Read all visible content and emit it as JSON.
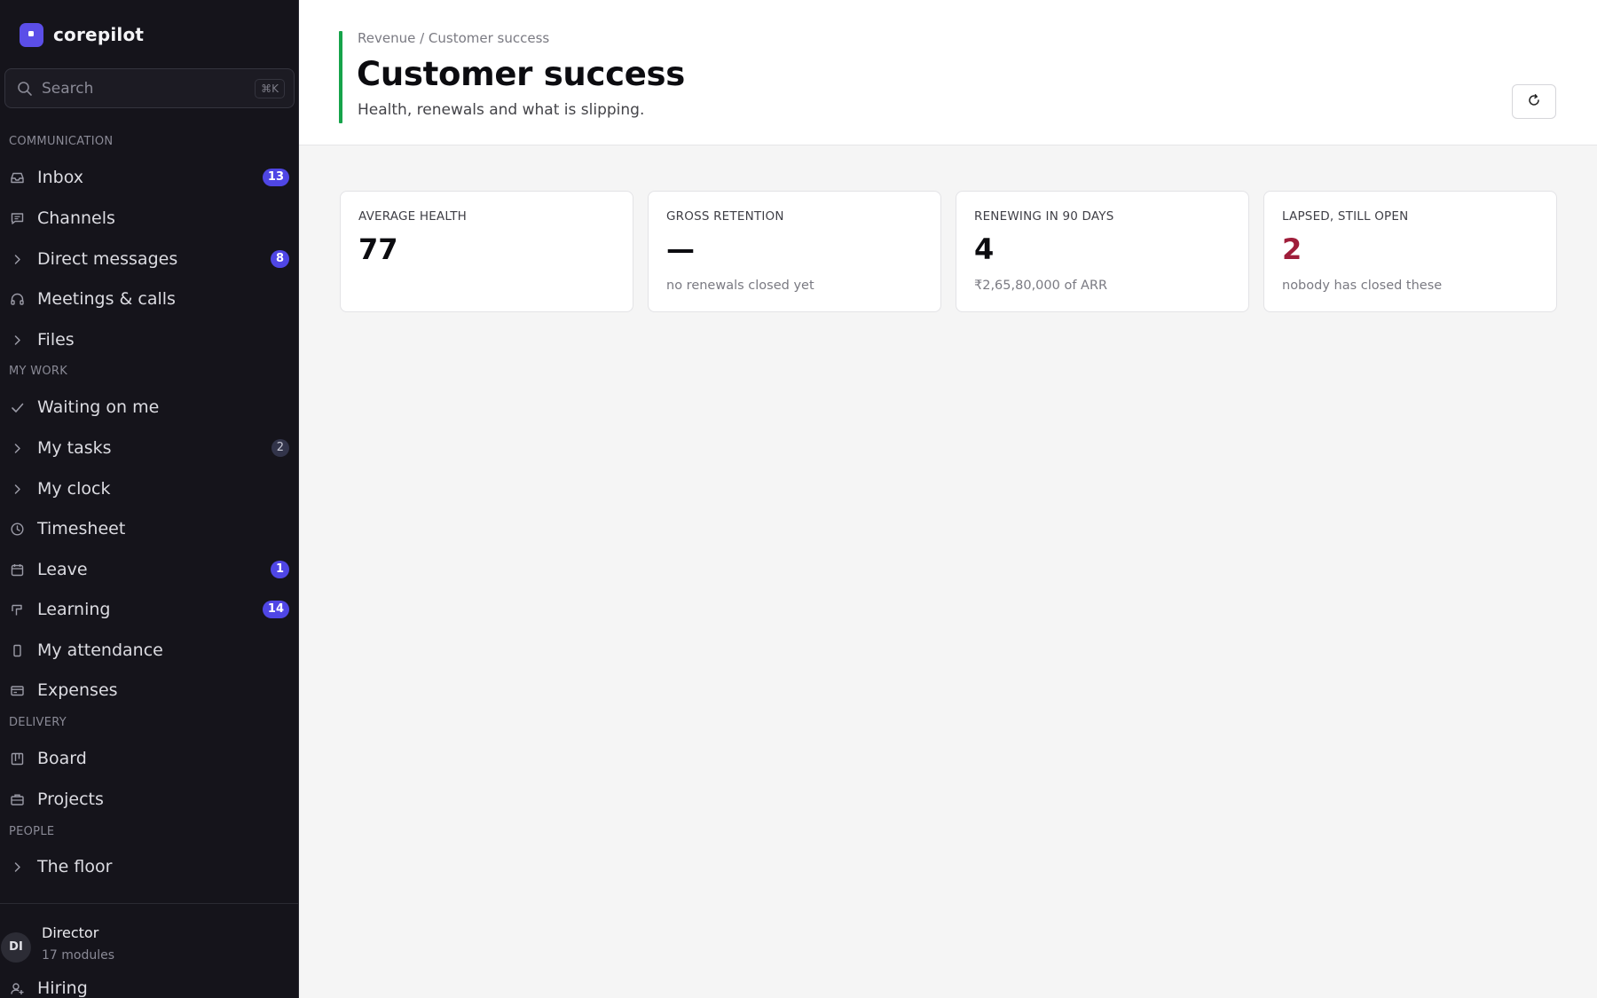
{
  "brand": {
    "name": "corepilot"
  },
  "search": {
    "placeholder": "Search",
    "shortcut": "⌘K"
  },
  "sidebar": {
    "sections": {
      "communication": "COMMUNICATION",
      "my_work": "MY WORK",
      "delivery": "DELIVERY",
      "people": "PEOPLE"
    },
    "items": [
      {
        "label": "Inbox",
        "icon": "inbox-icon",
        "badge": "13"
      },
      {
        "label": "Channels",
        "icon": "channels-icon"
      },
      {
        "label": "Direct messages",
        "icon": "chevron-right-icon",
        "badge": "8"
      },
      {
        "label": "Meetings & calls",
        "icon": "headset-icon"
      },
      {
        "label": "Files",
        "icon": "chevron-right-icon"
      },
      {
        "label": "Waiting on me",
        "icon": "check-icon"
      },
      {
        "label": "My tasks",
        "icon": "chevron-right-icon",
        "badge": "2"
      },
      {
        "label": "My clock",
        "icon": "chevron-right-icon"
      },
      {
        "label": "Timesheet",
        "icon": "clock-icon"
      },
      {
        "label": "Leave",
        "icon": "calendar-icon",
        "badge": "1"
      },
      {
        "label": "Learning",
        "icon": "learning-icon",
        "badge": "14"
      },
      {
        "label": "My attendance",
        "icon": "device-icon"
      },
      {
        "label": "Expenses",
        "icon": "card-icon"
      },
      {
        "label": "Board",
        "icon": "board-icon"
      },
      {
        "label": "Projects",
        "icon": "briefcase-icon"
      },
      {
        "label": "The floor",
        "icon": "chevron-right-icon"
      },
      {
        "label": "Hiring",
        "icon": "user-plus-icon"
      }
    ]
  },
  "profile": {
    "initials": "DI",
    "role": "Director",
    "modules": "17 modules"
  },
  "header": {
    "breadcrumb": "Revenue / Customer success",
    "title": "Customer success",
    "subtitle": "Health, renewals and what is slipping.",
    "refresh_icon": "refresh-icon"
  },
  "cards": [
    {
      "label": "AVERAGE HEALTH",
      "value": "77",
      "note": ""
    },
    {
      "label": "GROSS RETENTION",
      "value": "—",
      "note": "no renewals closed yet"
    },
    {
      "label": "RENEWING IN 90 DAYS",
      "value": "4",
      "note": "₹2,65,80,000 of ARR"
    },
    {
      "label": "LAPSED, STILL OPEN",
      "value": "2",
      "note": "nobody has closed these"
    }
  ],
  "colors": {
    "accent": "#5b4ee8",
    "badge": "#4f46e5",
    "header_bar": "#16a34a",
    "danger": "#9f1d3a",
    "sidebar_bg": "#15141b"
  }
}
